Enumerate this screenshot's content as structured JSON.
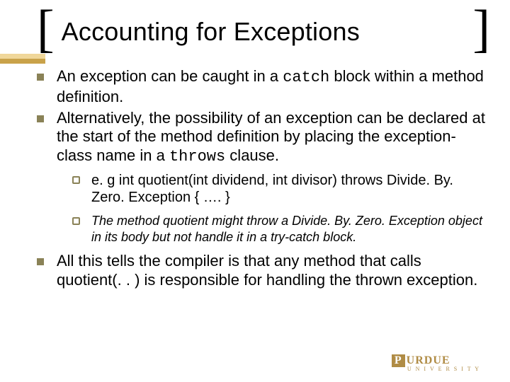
{
  "title": "Accounting for Exceptions",
  "bullets": [
    {
      "pre": "An exception can be caught in a ",
      "code": "catch",
      "post": "  block within a method definition."
    },
    {
      "pre": "Alternatively, the possibility of an exception can be declared at the start of the method definition by placing the exception-class name in a ",
      "code": "throws",
      "post": " clause."
    }
  ],
  "subbullets": [
    {
      "text": "e. g int quotient(int dividend, int divisor) throws Divide. By. Zero. Exception  { …. }",
      "italic": false
    },
    {
      "text": "The method quotient might throw a Divide. By. Zero. Exception object in its body but not handle it in a try-catch block.",
      "italic": true
    }
  ],
  "bullet3": "All this tells the compiler is that any method that calls quotient(. . ) is responsible for handling the thrown exception.",
  "logo": {
    "brand": "URDUE",
    "p": "P",
    "sub": "U N I V E R S I T Y"
  }
}
